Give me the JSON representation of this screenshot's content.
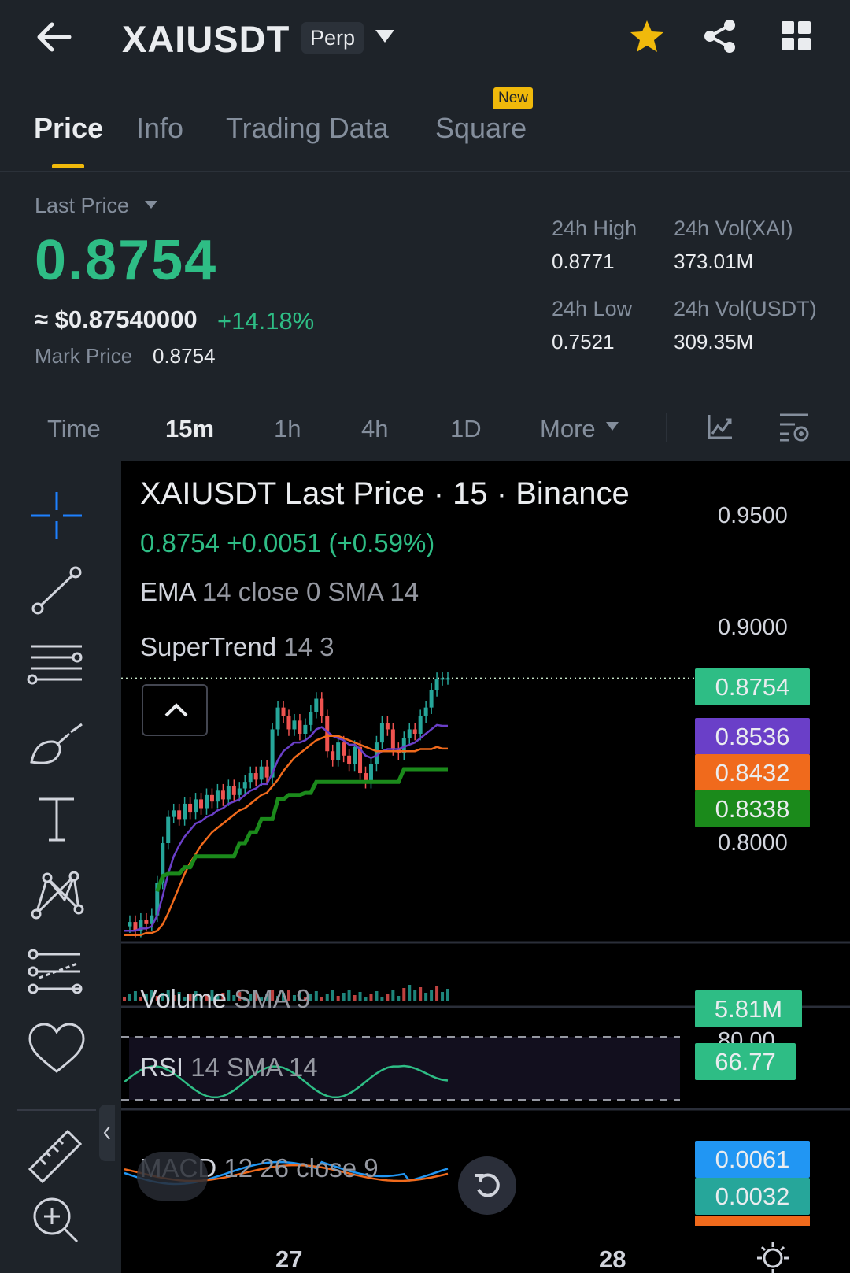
{
  "header": {
    "symbol": "XAIUSDT",
    "contract_type": "Perp",
    "icons": [
      "back-arrow-icon",
      "dropdown-caret-icon",
      "star-icon",
      "share-icon",
      "grid-icon"
    ],
    "favorite_color": "#f0b90b"
  },
  "tabs": [
    {
      "label": "Price",
      "active": true
    },
    {
      "label": "Info",
      "active": false
    },
    {
      "label": "Trading Data",
      "active": false
    },
    {
      "label": "Square",
      "active": false,
      "badge": "New"
    }
  ],
  "price": {
    "last_price_label": "Last Price",
    "last_price": "0.8754",
    "usd_value": "≈ $0.87540000",
    "change_pct": "+14.18%",
    "mark_price_label": "Mark Price",
    "mark_price": "0.8754",
    "up_color": "#2ebd85"
  },
  "stats": {
    "high_label": "24h High",
    "high": "0.8771",
    "low_label": "24h Low",
    "low": "0.7521",
    "vol_base_label": "24h Vol(XAI)",
    "vol_base": "373.01M",
    "vol_quote_label": "24h Vol(USDT)",
    "vol_quote": "309.35M"
  },
  "timeframes": {
    "items": [
      "Time",
      "15m",
      "1h",
      "4h",
      "1D"
    ],
    "active": "15m",
    "more_label": "More"
  },
  "chart": {
    "title": "XAIUSDT Last Price · 15 · Binance",
    "ohlc_summary": "0.8754  +0.0051 (+0.59%)",
    "ema_label": "EMA",
    "ema_params": "14 close 0 SMA 14",
    "supertrend_label": "SuperTrend",
    "supertrend_params": "14 3",
    "volume_label": "Volume",
    "volume_params": "SMA 9",
    "rsi_label": "RSI",
    "rsi_params": "14 SMA 14",
    "macd_label": "MACD",
    "macd_params": "12 26 close 9",
    "price_axis": [
      "0.9500",
      "0.9000",
      "0.8000"
    ],
    "rsi_axis": "80.00",
    "tags": {
      "last": "0.8754",
      "ema": "0.8536",
      "sma": "0.8432",
      "supertrend": "0.8338",
      "volume": "5.81M",
      "rsi": "66.77",
      "macd": "0.0061",
      "signal": "0.0032"
    },
    "tag_colors": {
      "last": "#2ebd85",
      "ema": "#6a3fc8",
      "sma": "#f06a1c",
      "supertrend": "#1b8a1b",
      "volume": "#2ebd85",
      "rsi": "#2ebd85",
      "macd": "#2196f3",
      "signal": "#26a69a"
    },
    "date_labels": [
      "27",
      "28"
    ]
  },
  "chart_data": {
    "type": "line",
    "x": [
      0,
      1,
      2,
      3,
      4,
      5,
      6,
      7,
      8,
      9,
      10,
      11,
      12,
      13,
      14,
      15,
      16,
      17,
      18,
      19,
      20,
      21,
      22,
      23,
      24,
      25,
      26,
      27,
      28,
      29,
      30,
      31,
      32,
      33,
      34,
      35,
      36,
      37,
      38,
      39,
      40,
      41,
      42,
      43,
      44,
      45,
      46,
      47,
      48,
      49,
      50,
      51,
      52,
      53,
      54,
      55,
      56,
      57,
      58,
      59
    ],
    "series": [
      {
        "name": "Last Price",
        "color": "#2ebd85",
        "values": [
          0.762,
          0.764,
          0.76,
          0.765,
          0.763,
          0.767,
          0.782,
          0.8,
          0.812,
          0.815,
          0.811,
          0.818,
          0.814,
          0.82,
          0.816,
          0.822,
          0.819,
          0.824,
          0.82,
          0.826,
          0.822,
          0.825,
          0.828,
          0.832,
          0.829,
          0.835,
          0.83,
          0.852,
          0.862,
          0.858,
          0.852,
          0.856,
          0.85,
          0.854,
          0.86,
          0.866,
          0.858,
          0.842,
          0.838,
          0.846,
          0.84,
          0.836,
          0.844,
          0.832,
          0.828,
          0.836,
          0.846,
          0.855,
          0.852,
          0.843,
          0.841,
          0.848,
          0.852,
          0.85,
          0.858,
          0.862,
          0.87,
          0.875,
          0.8754,
          0.8754
        ]
      },
      {
        "name": "EMA",
        "color": "#6a3fc8",
        "values": [
          0.76,
          0.76,
          0.76,
          0.761,
          0.761,
          0.762,
          0.767,
          0.776,
          0.786,
          0.794,
          0.799,
          0.803,
          0.806,
          0.809,
          0.81,
          0.812,
          0.813,
          0.815,
          0.816,
          0.818,
          0.819,
          0.82,
          0.822,
          0.824,
          0.825,
          0.827,
          0.827,
          0.832,
          0.838,
          0.842,
          0.844,
          0.846,
          0.846,
          0.847,
          0.849,
          0.852,
          0.853,
          0.851,
          0.849,
          0.848,
          0.847,
          0.845,
          0.845,
          0.843,
          0.84,
          0.839,
          0.84,
          0.842,
          0.843,
          0.843,
          0.843,
          0.844,
          0.845,
          0.846,
          0.848,
          0.85,
          0.852,
          0.854,
          0.8536,
          0.8536
        ]
      },
      {
        "name": "SMA",
        "color": "#f06a1c",
        "values": [
          0.758,
          0.758,
          0.758,
          0.758,
          0.759,
          0.759,
          0.76,
          0.763,
          0.768,
          0.774,
          0.78,
          0.786,
          0.791,
          0.795,
          0.799,
          0.802,
          0.805,
          0.807,
          0.809,
          0.811,
          0.813,
          0.815,
          0.816,
          0.818,
          0.82,
          0.822,
          0.823,
          0.826,
          0.829,
          0.833,
          0.836,
          0.839,
          0.841,
          0.843,
          0.845,
          0.847,
          0.848,
          0.849,
          0.849,
          0.849,
          0.848,
          0.847,
          0.846,
          0.845,
          0.844,
          0.843,
          0.842,
          0.842,
          0.842,
          0.842,
          0.842,
          0.842,
          0.842,
          0.842,
          0.843,
          0.843,
          0.843,
          0.844,
          0.8432,
          0.8432
        ]
      },
      {
        "name": "SuperTrend",
        "color": "#1b8a1b",
        "values": [
          null,
          null,
          null,
          null,
          null,
          null,
          0.778,
          0.785,
          0.786,
          0.786,
          0.786,
          0.789,
          0.789,
          0.794,
          0.794,
          0.794,
          0.794,
          0.794,
          0.794,
          0.794,
          0.794,
          0.8,
          0.8,
          0.805,
          0.805,
          0.811,
          0.811,
          0.811,
          0.82,
          0.82,
          0.822,
          0.822,
          0.822,
          0.823,
          0.823,
          0.828,
          0.828,
          0.828,
          0.828,
          0.828,
          0.828,
          0.828,
          0.828,
          0.828,
          0.828,
          0.828,
          0.828,
          0.828,
          0.828,
          0.828,
          0.828,
          0.8338,
          0.8338,
          0.8338,
          0.8338,
          0.8338,
          0.8338,
          0.8338,
          0.8338,
          0.8338
        ]
      }
    ],
    "ylim": [
      0.745,
      0.97
    ],
    "y_ticks": [
      0.95,
      0.9,
      0.8
    ],
    "x_tick_labels": [
      "27",
      "28"
    ],
    "grid": false
  }
}
